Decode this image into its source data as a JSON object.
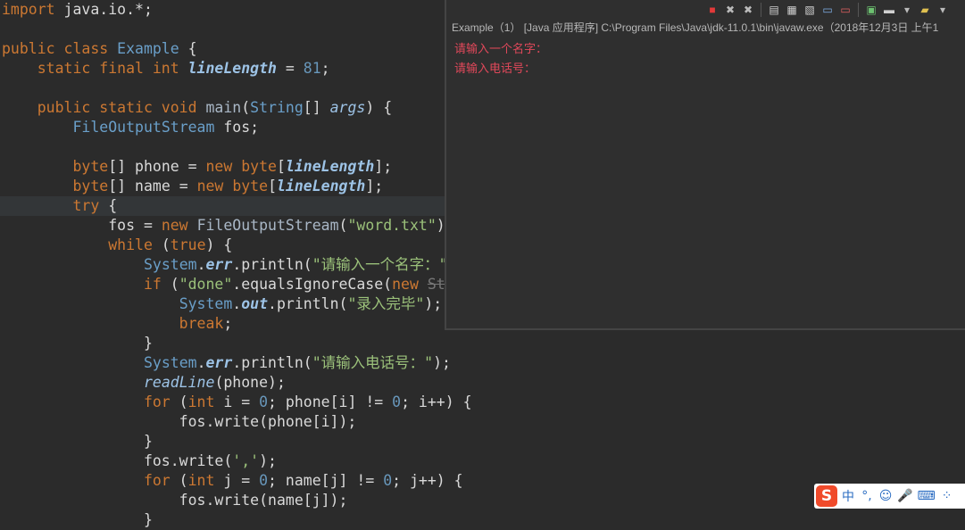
{
  "editor": {
    "lines": [
      {
        "tokens": [
          {
            "t": "import",
            "c": "kw"
          },
          {
            "t": " java.io.*;",
            "c": "var"
          }
        ]
      },
      {
        "tokens": []
      },
      {
        "tokens": [
          {
            "t": "public class ",
            "c": "kw"
          },
          {
            "t": "Example",
            "c": "cls"
          },
          {
            "t": " {",
            "c": "var"
          }
        ]
      },
      {
        "tokens": [
          {
            "t": "    static final int ",
            "c": "kw"
          },
          {
            "t": "lineLength",
            "c": "fld"
          },
          {
            "t": " = ",
            "c": "var"
          },
          {
            "t": "81",
            "c": "num"
          },
          {
            "t": ";",
            "c": "var"
          }
        ]
      },
      {
        "tokens": []
      },
      {
        "tokens": [
          {
            "t": "    public static void ",
            "c": "kw"
          },
          {
            "t": "main",
            "c": "mth"
          },
          {
            "t": "(",
            "c": "var"
          },
          {
            "t": "String",
            "c": "cls"
          },
          {
            "t": "[] ",
            "c": "var"
          },
          {
            "t": "args",
            "c": "fn"
          },
          {
            "t": ") {",
            "c": "var"
          }
        ]
      },
      {
        "tokens": [
          {
            "t": "        ",
            "c": "var"
          },
          {
            "t": "FileOutputStream",
            "c": "cls"
          },
          {
            "t": " fos;",
            "c": "var"
          }
        ]
      },
      {
        "tokens": []
      },
      {
        "tokens": [
          {
            "t": "        byte",
            "c": "kw"
          },
          {
            "t": "[] phone = ",
            "c": "var"
          },
          {
            "t": "new ",
            "c": "kw"
          },
          {
            "t": "byte",
            "c": "kw"
          },
          {
            "t": "[",
            "c": "var"
          },
          {
            "t": "lineLength",
            "c": "fld"
          },
          {
            "t": "];",
            "c": "var"
          }
        ]
      },
      {
        "tokens": [
          {
            "t": "        byte",
            "c": "kw"
          },
          {
            "t": "[] name = ",
            "c": "var"
          },
          {
            "t": "new ",
            "c": "kw"
          },
          {
            "t": "byte",
            "c": "kw"
          },
          {
            "t": "[",
            "c": "var"
          },
          {
            "t": "lineLength",
            "c": "fld"
          },
          {
            "t": "];",
            "c": "var"
          }
        ]
      },
      {
        "tokens": [
          {
            "t": "        try",
            "c": "kw"
          },
          {
            "t": " {",
            "c": "var"
          }
        ]
      },
      {
        "tokens": [
          {
            "t": "            fos = ",
            "c": "var"
          },
          {
            "t": "new ",
            "c": "kw"
          },
          {
            "t": "FileOutputStream",
            "c": "mth"
          },
          {
            "t": "(",
            "c": "var"
          },
          {
            "t": "\"word.txt\"",
            "c": "str"
          },
          {
            "t": ")",
            "c": "var"
          }
        ]
      },
      {
        "tokens": [
          {
            "t": "            while",
            "c": "kw"
          },
          {
            "t": " (",
            "c": "var"
          },
          {
            "t": "true",
            "c": "kw"
          },
          {
            "t": ") {",
            "c": "var"
          }
        ]
      },
      {
        "tokens": [
          {
            "t": "                ",
            "c": "var"
          },
          {
            "t": "System",
            "c": "cls"
          },
          {
            "t": ".",
            "c": "var"
          },
          {
            "t": "err",
            "c": "sfld"
          },
          {
            "t": ".println(",
            "c": "var"
          },
          {
            "t": "\"请输入一个名字：\"",
            "c": "str"
          },
          {
            "t": ")",
            "c": "var"
          }
        ]
      },
      {
        "tokens": [
          {
            "t": "                if",
            "c": "kw"
          },
          {
            "t": " (",
            "c": "var"
          },
          {
            "t": "\"done\"",
            "c": "str"
          },
          {
            "t": ".equalsIgnoreCase(",
            "c": "var"
          },
          {
            "t": "new ",
            "c": "kw"
          },
          {
            "t": "St",
            "c": "strike"
          }
        ]
      },
      {
        "tokens": [
          {
            "t": "                    ",
            "c": "var"
          },
          {
            "t": "System",
            "c": "cls"
          },
          {
            "t": ".",
            "c": "var"
          },
          {
            "t": "out",
            "c": "sfld"
          },
          {
            "t": ".println(",
            "c": "var"
          },
          {
            "t": "\"录入完毕\"",
            "c": "str"
          },
          {
            "t": ");",
            "c": "var"
          }
        ]
      },
      {
        "tokens": [
          {
            "t": "                    break",
            "c": "kw"
          },
          {
            "t": ";",
            "c": "var"
          }
        ]
      },
      {
        "tokens": [
          {
            "t": "                }",
            "c": "var"
          }
        ]
      },
      {
        "tokens": [
          {
            "t": "                ",
            "c": "var"
          },
          {
            "t": "System",
            "c": "cls"
          },
          {
            "t": ".",
            "c": "var"
          },
          {
            "t": "err",
            "c": "sfld"
          },
          {
            "t": ".println(",
            "c": "var"
          },
          {
            "t": "\"请输入电话号：\"",
            "c": "str"
          },
          {
            "t": ");",
            "c": "var"
          }
        ]
      },
      {
        "tokens": [
          {
            "t": "                ",
            "c": "var"
          },
          {
            "t": "readLine",
            "c": "fn"
          },
          {
            "t": "(phone);",
            "c": "var"
          }
        ]
      },
      {
        "tokens": [
          {
            "t": "                for",
            "c": "kw"
          },
          {
            "t": " (",
            "c": "var"
          },
          {
            "t": "int",
            "c": "kw"
          },
          {
            "t": " i = ",
            "c": "var"
          },
          {
            "t": "0",
            "c": "num"
          },
          {
            "t": "; phone[i] != ",
            "c": "var"
          },
          {
            "t": "0",
            "c": "num"
          },
          {
            "t": "; i++) {",
            "c": "var"
          }
        ]
      },
      {
        "tokens": [
          {
            "t": "                    fos.write(phone[i]);",
            "c": "var"
          }
        ]
      },
      {
        "tokens": [
          {
            "t": "                }",
            "c": "var"
          }
        ]
      },
      {
        "tokens": [
          {
            "t": "                fos.write(",
            "c": "var"
          },
          {
            "t": "','",
            "c": "str"
          },
          {
            "t": ");",
            "c": "var"
          }
        ]
      },
      {
        "tokens": [
          {
            "t": "                for",
            "c": "kw"
          },
          {
            "t": " (",
            "c": "var"
          },
          {
            "t": "int",
            "c": "kw"
          },
          {
            "t": " j = ",
            "c": "var"
          },
          {
            "t": "0",
            "c": "num"
          },
          {
            "t": "; name[j] != ",
            "c": "var"
          },
          {
            "t": "0",
            "c": "num"
          },
          {
            "t": "; j++) {",
            "c": "var"
          }
        ]
      },
      {
        "tokens": [
          {
            "t": "                    fos.write(name[j]);",
            "c": "var"
          }
        ]
      },
      {
        "tokens": [
          {
            "t": "                }",
            "c": "var"
          }
        ]
      }
    ]
  },
  "console": {
    "title": "Example（1） [Java 应用程序] C:\\Program Files\\Java\\jdk-11.0.1\\bin\\javaw.exe（2018年12月3日 上午1",
    "output": [
      "请输入一个名字：",
      "请输入电话号："
    ],
    "toolbar": [
      {
        "name": "terminate-icon",
        "glyph": "■",
        "color": "#e23a3a"
      },
      {
        "name": "remove-launch-icon",
        "glyph": "✖",
        "color": "#bbbbbb"
      },
      {
        "name": "remove-all-icon",
        "glyph": "✖",
        "color": "#bbbbbb"
      },
      {
        "sep": true
      },
      {
        "name": "scroll-lock-icon",
        "glyph": "▤",
        "color": "#d0d0d0"
      },
      {
        "name": "word-wrap-icon",
        "glyph": "▦",
        "color": "#d0d0d0"
      },
      {
        "name": "clear-console-icon",
        "glyph": "▧",
        "color": "#d0d0d0"
      },
      {
        "name": "show-stdout-icon",
        "glyph": "▭",
        "color": "#7fb0e8"
      },
      {
        "name": "show-stderr-icon",
        "glyph": "▭",
        "color": "#e06060"
      },
      {
        "sep": true
      },
      {
        "name": "pin-console-icon",
        "glyph": "▣",
        "color": "#6cc070"
      },
      {
        "name": "display-console-icon",
        "glyph": "▬",
        "color": "#d0d0d0"
      },
      {
        "name": "display-console-dropdown-icon",
        "glyph": "▾",
        "color": "#bbbbbb"
      },
      {
        "name": "open-console-icon",
        "glyph": "▰",
        "color": "#e0c050"
      },
      {
        "name": "open-console-dropdown-icon",
        "glyph": "▾",
        "color": "#bbbbbb"
      }
    ]
  },
  "ime": {
    "logo": "S",
    "items": [
      {
        "name": "ime-mode-chinese",
        "text": "中"
      },
      {
        "name": "ime-punctuation-icon",
        "text": "°,"
      },
      {
        "name": "ime-emoji-icon",
        "text": "☺"
      },
      {
        "name": "ime-voice-icon",
        "text": "🎤"
      },
      {
        "name": "ime-keyboard-icon",
        "text": "⌨"
      },
      {
        "name": "ime-skin-icon",
        "text": "⁘"
      }
    ]
  },
  "colors": {
    "editor_bg": "#2b2b2b",
    "keyword": "#cc7832",
    "string": "#9bc17a",
    "number": "#6897bb",
    "console_err": "#e0485a"
  }
}
